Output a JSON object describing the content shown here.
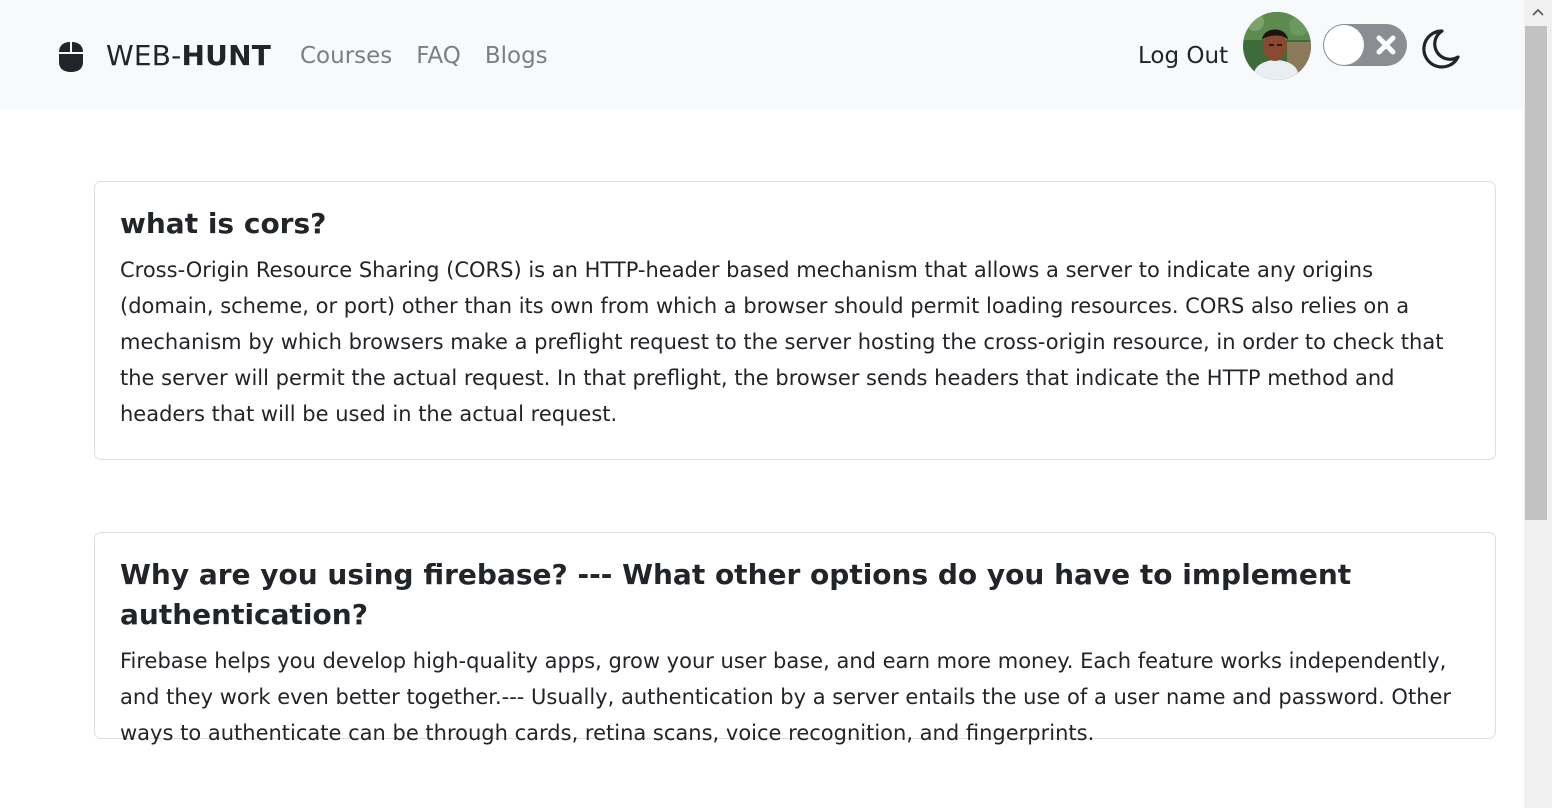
{
  "navbar": {
    "brand_prefix": "WEB-",
    "brand_bold": "HUNT",
    "links": [
      "Courses",
      "FAQ",
      "Blogs"
    ],
    "logout_label": "Log Out",
    "icons": {
      "brand": "mouse-icon",
      "toggle": "theme-toggle-switch",
      "moon": "moon-icon"
    },
    "toggle_state": "off"
  },
  "cards": [
    {
      "title": "what is cors?",
      "body": "Cross-Origin Resource Sharing (CORS) is an HTTP-header based mechanism that allows a server to indicate any origins (domain, scheme, or port) other than its own from which a browser should permit loading resources. CORS also relies on a mechanism by which browsers make a preflight request to the server hosting the cross-origin resource, in order to check that the server will permit the actual request. In that preflight, the browser sends headers that indicate the HTTP method and headers that will be used in the actual request."
    },
    {
      "title": "Why are you using firebase? --- What other options do you have to implement authentication?",
      "body": "Firebase helps you develop high-quality apps, grow your user base, and earn more money. Each feature works independently, and they work even better together.--- Usually, authentication by a server entails the use of a user name and password. Other ways to authenticate can be through cards, retina scans, voice recognition, and fingerprints."
    }
  ],
  "colors": {
    "navbar_bg": "#f8f9fa",
    "nav_link": "#7a7f85",
    "text": "#212529",
    "card_border": "#dcdee1",
    "toggle_bg": "#8a8d91"
  }
}
